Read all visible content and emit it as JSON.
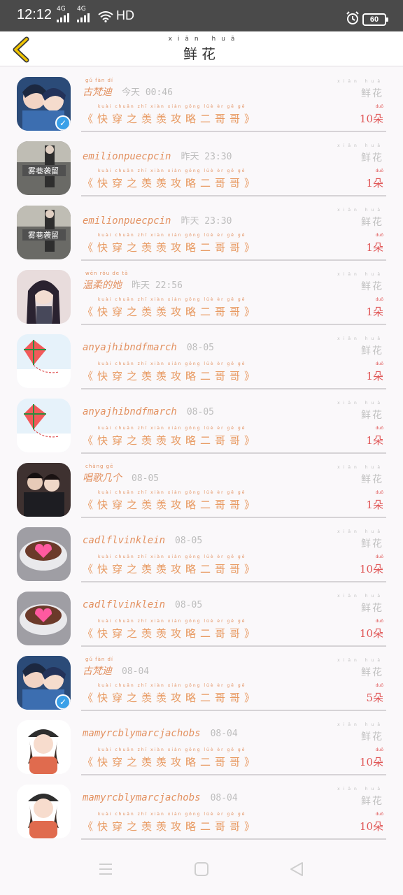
{
  "status_bar": {
    "time": "12:12",
    "network1": "4G",
    "network2": "4G",
    "hd": "HD",
    "battery": "60"
  },
  "header": {
    "title": "鲜花",
    "title_pinyin": "xiān huā"
  },
  "rows": [
    {
      "name": "古梵迪",
      "name_pinyin": "gǔ fàn dí",
      "time": "今天 00:46",
      "title": "《快穿之羡羡攻略二哥哥》",
      "flower": "鲜花",
      "count": "10朵",
      "avatar": "anime",
      "verified": true
    },
    {
      "name": "emilionpuecpcin",
      "name_pinyin": "",
      "time": "昨天 23:30",
      "title": "《快穿之羡羡攻略二哥哥》",
      "flower": "鲜花",
      "count": "1朵",
      "avatar": "street",
      "verified": false
    },
    {
      "name": "emilionpuecpcin",
      "name_pinyin": "",
      "time": "昨天 23:30",
      "title": "《快穿之羡羡攻略二哥哥》",
      "flower": "鲜花",
      "count": "1朵",
      "avatar": "street",
      "verified": false
    },
    {
      "name": "温柔的她",
      "name_pinyin": "wēn róu de tā",
      "time": "昨天 22:56",
      "title": "《快穿之羡羡攻略二哥哥》",
      "flower": "鲜花",
      "count": "1朵",
      "avatar": "girl",
      "verified": false
    },
    {
      "name": "anyajhibndfmarch",
      "name_pinyin": "",
      "time": "08-05",
      "title": "《快穿之羡羡攻略二哥哥》",
      "flower": "鲜花",
      "count": "1朵",
      "avatar": "kite",
      "verified": false
    },
    {
      "name": "anyajhibndfmarch",
      "name_pinyin": "",
      "time": "08-05",
      "title": "《快穿之羡羡攻略二哥哥》",
      "flower": "鲜花",
      "count": "1朵",
      "avatar": "kite",
      "verified": false
    },
    {
      "name": "唱歌几个",
      "name_pinyin": "chàng gē",
      "time": "08-05",
      "title": "《快穿之羡羡攻略二哥哥》",
      "flower": "鲜花",
      "count": "1朵",
      "avatar": "couple",
      "verified": false
    },
    {
      "name": "cadlflvinklein",
      "name_pinyin": "",
      "time": "08-05",
      "title": "《快穿之羡羡攻略二哥哥》",
      "flower": "鲜花",
      "count": "10朵",
      "avatar": "coffee",
      "verified": false
    },
    {
      "name": "cadlflvinklein",
      "name_pinyin": "",
      "time": "08-05",
      "title": "《快穿之羡羡攻略二哥哥》",
      "flower": "鲜花",
      "count": "10朵",
      "avatar": "coffee",
      "verified": false
    },
    {
      "name": "古梵迪",
      "name_pinyin": "gǔ fàn dí",
      "time": "08-04",
      "title": "《快穿之羡羡攻略二哥哥》",
      "flower": "鲜花",
      "count": "5朵",
      "avatar": "anime",
      "verified": true
    },
    {
      "name": "mamyrcblymarcjachobs",
      "name_pinyin": "",
      "time": "08-04",
      "title": "《快穿之羡羡攻略二哥哥》",
      "flower": "鲜花",
      "count": "10朵",
      "avatar": "kid",
      "verified": false
    },
    {
      "name": "mamyrcblymarcjachobs",
      "name_pinyin": "",
      "time": "08-04",
      "title": "《快穿之羡羡攻略二哥哥》",
      "flower": "鲜花",
      "count": "10朵",
      "avatar": "kid",
      "verified": false
    }
  ],
  "title_pinyin": "kuài chuān zhī xiàn xiàn gōng lüè èr gē gē",
  "flower_pinyin": "xiān huā",
  "count_pinyin": "duǒ",
  "colors": {
    "accent": "#e39262",
    "count": "#e05656",
    "muted": "#c2c2c2"
  }
}
